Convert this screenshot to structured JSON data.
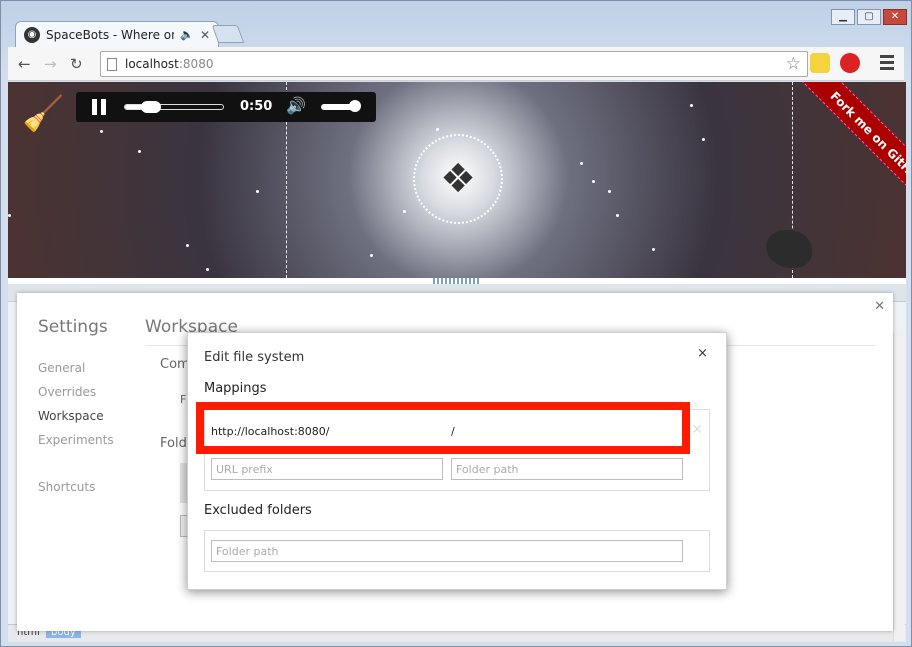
{
  "browser": {
    "tab_title": "SpaceBots - Where on",
    "url_host": "localhost",
    "url_port": ":8080"
  },
  "game": {
    "player_time": "0:50",
    "seek_progress": 0.2,
    "volume_level": 0.85,
    "ribbon_text": "Fork me on GitHub"
  },
  "settings": {
    "title": "Settings",
    "nav": [
      "General",
      "Overrides",
      "Workspace",
      "Experiments"
    ],
    "nav_extra": "Shortcuts",
    "selected": "Workspace",
    "panel_title": "Workspace",
    "section_1": "Com",
    "section_1_sub": "F",
    "section_2": "Fold"
  },
  "devtools": {
    "breadcrumb": [
      "html",
      "body"
    ]
  },
  "dialog": {
    "title": "Edit file system",
    "close_label": "×",
    "mappings_heading": "Mappings",
    "mapping": {
      "url_prefix": "http://localhost:8080/",
      "folder_path": "/"
    },
    "new_url_placeholder": "URL prefix",
    "new_folder_placeholder": "Folder path",
    "excluded_heading": "Excluded folders",
    "excluded_placeholder": "Folder path"
  },
  "colors": {
    "highlight": "#ff1a00",
    "ribbon": "#aa0000"
  }
}
